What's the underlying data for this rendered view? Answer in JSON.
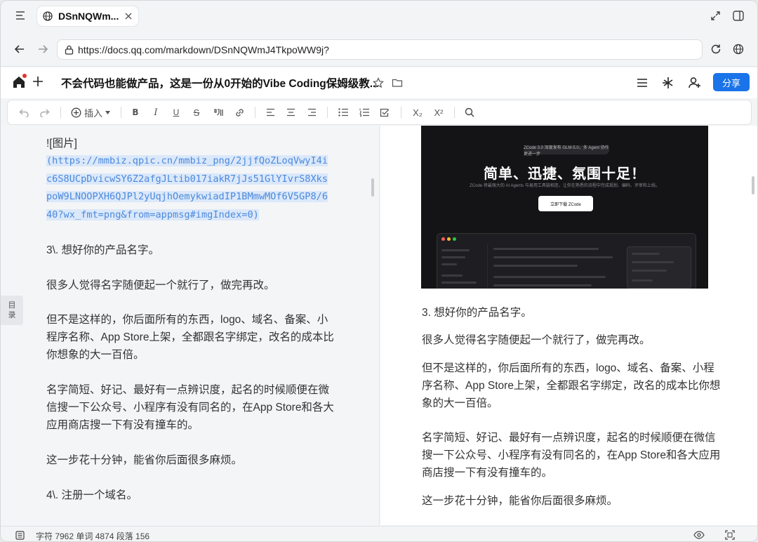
{
  "browser": {
    "tab_title": "DSnNQWm...",
    "url": "https://docs.qq.com/markdown/DSnNQWmJ4TkpoWW9j?"
  },
  "doc": {
    "title": "不会代码也能做产品，这是一份从0开始的Vibe Coding保姆级教...",
    "share_label": "分享"
  },
  "toolbar": {
    "insert_label": "插入",
    "subscript": "X₂",
    "superscript": "X²"
  },
  "toc_label": [
    "目",
    "录"
  ],
  "editor": {
    "image_tag": "![图片]",
    "image_url_lines": [
      "(https://mmbiz.qpic.cn/mmbiz_png/2jjfQoZLoqVwyI4i",
      "c6S8UCpDvicwSY6Z2afgJLtib017iakR7jJs51GlYIvrS8Xks",
      "poW9LNOOPXH6QJPl2yUqjhOemykwiadIP1BMmwMOf6V5GP8/6",
      "40?wx_fmt=png&from=appmsg#imgIndex=0)"
    ],
    "p1": "3\\. 想好你的产品名字。",
    "p2": "很多人觉得名字随便起一个就行了，做完再改。",
    "p3_lines": [
      "但不是这样的，你后面所有的东西，logo、域名、备案、小",
      "程序名称、App Store上架，全都跟名字绑定，改名的成本比",
      "你想象的大一百倍。"
    ],
    "p4_lines": [
      "名字简短、好记、最好有一点辨识度，起名的时候顺便在微",
      "信搜一下公众号、小程序有没有同名的，在App Store和各大",
      "应用商店搜一下有没有撞车的。"
    ],
    "p5": "这一步花十分钟，能省你后面很多麻烦。",
    "p6": "4\\. 注册一个域名。"
  },
  "preview": {
    "image": {
      "badge": "ZCode 3.0 深度发布 GLM-5.0，多 Agent 协作更进一步",
      "headline": "简单、迅捷、氛围十足！",
      "subline": "ZCode 将最强大的 AI Agents 与易用工具链相连，让你在熟悉的流程中完成规划、编码、评审和上线。",
      "button": "立即下载 ZCode"
    },
    "p1": "3. 想好你的产品名字。",
    "p2": "很多人觉得名字随便起一个就行了，做完再改。",
    "p3_lines": [
      "但不是这样的，你后面所有的东西，logo、域名、备案、小程",
      "序名称、App Store上架，全都跟名字绑定，改名的成本比你想",
      "象的大一百倍。"
    ],
    "p4_lines": [
      "名字简短、好记、最好有一点辨识度，起名的时候顺便在微信",
      "搜一下公众号、小程序有没有同名的，在App Store和各大应用",
      "商店搜一下有没有撞车的。"
    ],
    "p5": "这一步花十分钟，能省你后面很多麻烦。"
  },
  "status": {
    "stats": "字符 7962 单词 4874 段落 156"
  },
  "colors": {
    "accent": "#1a73e8",
    "link": "#4a89dc",
    "notify_dot": "#e5322d"
  }
}
